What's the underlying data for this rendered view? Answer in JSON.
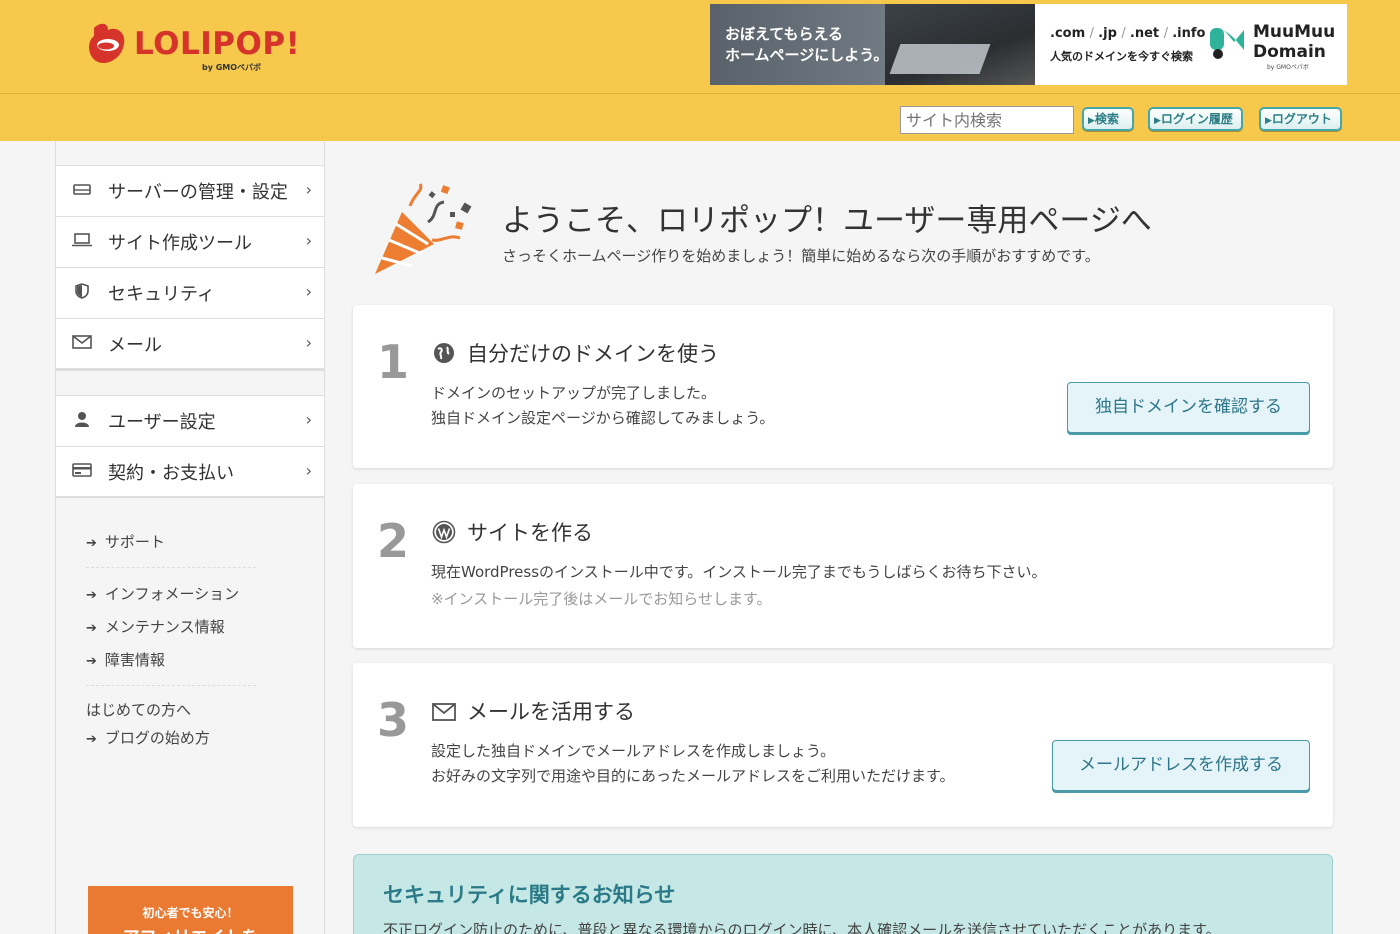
{
  "header": {
    "logo_text": "LOLIPOP!",
    "logo_sub": "by GMOペパボ",
    "banner": {
      "left_line1": "おぼえてもらえる",
      "left_line2": "ホームページにしよう。",
      "domains": [
        ".com",
        ".jp",
        ".net",
        ".info"
      ],
      "sub": "人気のドメインを今すぐ検索",
      "brand_line1": "MuuMuu",
      "brand_line2": "Domain",
      "brand_sub": "by GMOペパボ"
    },
    "search_placeholder": "サイト内検索",
    "buttons": {
      "search": "検索",
      "login_history": "ログイン履歴",
      "logout": "ログアウト"
    }
  },
  "sidebar": {
    "group1": [
      {
        "label": "サーバーの管理・設定",
        "icon": "server-icon"
      },
      {
        "label": "サイト作成ツール",
        "icon": "laptop-icon"
      },
      {
        "label": "セキュリティ",
        "icon": "shield-icon"
      },
      {
        "label": "メール",
        "icon": "mail-icon"
      }
    ],
    "group2": [
      {
        "label": "ユーザー設定",
        "icon": "user-icon"
      },
      {
        "label": "契約・お支払い",
        "icon": "credit-card-icon"
      }
    ],
    "links_a": [
      "サポート"
    ],
    "links_b": [
      "インフォメーション",
      "メンテナンス情報",
      "障害情報"
    ],
    "plain_text": "はじめての方へ",
    "links_c": [
      "ブログの始め方"
    ],
    "affiliate": {
      "small": "初心者でも安心！",
      "big": "アフィリエイトを"
    }
  },
  "main": {
    "title": "ようこそ、ロリポップ！ユーザー専用ページへ",
    "subtitle": "さっそくホームページ作りを始めましょう！簡単に始めるなら次の手順がおすすめです。",
    "steps": [
      {
        "num": "1",
        "title": "自分だけのドメインを使う",
        "icon": "globe-icon",
        "lines": [
          "ドメインのセットアップが完了しました。",
          "独自ドメイン設定ページから確認してみましょう。"
        ],
        "button": "独自ドメインを確認する"
      },
      {
        "num": "2",
        "title": "サイトを作る",
        "icon": "wordpress-icon",
        "lines": [
          "現在WordPressのインストール中です。インストール完了までもうしばらくお待ち下さい。"
        ],
        "note": "※インストール完了後はメールでお知らせします。"
      },
      {
        "num": "3",
        "title": "メールを活用する",
        "icon": "mail-icon",
        "lines": [
          "設定した独自ドメインでメールアドレスを作成しましょう。",
          "お好みの文字列で用途や目的にあったメールアドレスをご利用いただけます。"
        ],
        "button": "メールアドレスを作成する"
      }
    ],
    "notice": {
      "title": "セキュリティに関するお知らせ",
      "body": "不正ログイン防止のために、普段と異なる環境からのログイン時に、本人確認メールを送信させていただくことがあります。"
    }
  }
}
